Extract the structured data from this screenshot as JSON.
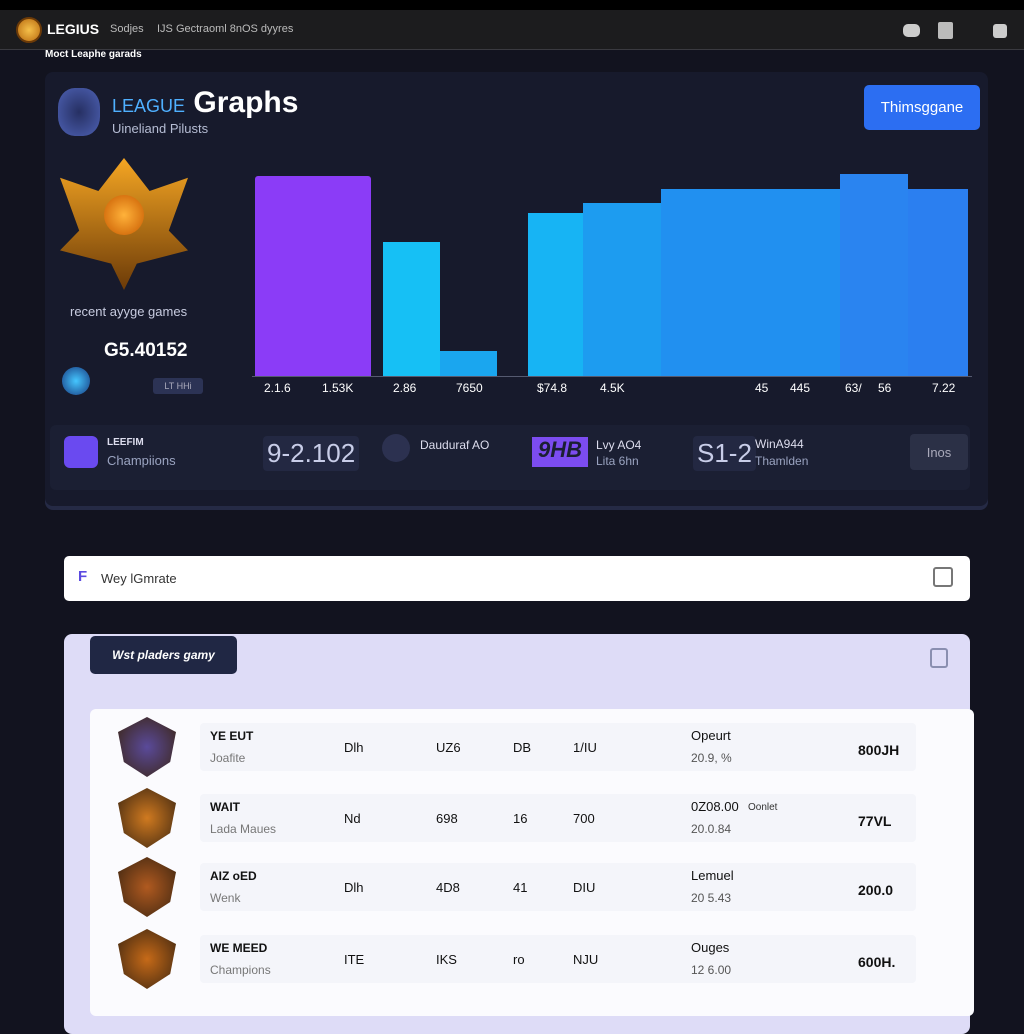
{
  "nav": {
    "brand": "LEGIUS",
    "links": [
      "Sodjes",
      "IJS Gectraoml 8nOS dyyres"
    ],
    "sub_title": "Moct Leaphe garads",
    "icons": [
      "chat-icon",
      "document-icon",
      "user-icon"
    ]
  },
  "header": {
    "title_small": "LEAGUE",
    "title": "Graphs",
    "subtitle": "Uineliand Pilusts",
    "button": "Thimsggane"
  },
  "left": {
    "label": "recent ayyge games",
    "value": "G5.40152",
    "pill": "LT HHi"
  },
  "chart_data": {
    "type": "bar",
    "colors": [
      "#8b3cf7",
      "#16c0f5",
      "#1aa6ef",
      "#17b4f4",
      "#1d9cf0",
      "#2190f0",
      "#2a84f0",
      "#2b7ff0"
    ],
    "levels_percent": [
      97,
      65,
      12,
      79,
      84,
      91,
      98,
      91
    ],
    "tick_labels": [
      "2.1.6",
      "1.53K",
      "2.86",
      "7650",
      "$74.8",
      "4.5K",
      "45",
      "445",
      "63/",
      "56",
      "7.22"
    ]
  },
  "stats": [
    {
      "title": "LEEFIM",
      "sub": "Champiions"
    },
    {
      "big": "9-2.102"
    },
    {
      "title": "Dauduraf AO"
    },
    {
      "big": "9HB",
      "title": "Lvy AO4",
      "sub": "Lita 6hn"
    },
    {
      "big": "S1-2",
      "title": "WinA944",
      "sub": "Thamlden"
    }
  ],
  "stats_button": "Inos",
  "search": {
    "prefix": "F",
    "value": "Wey lGmrate"
  },
  "card": {
    "chip": "Wst pladers gamy",
    "rows": [
      {
        "name": "YE EUT",
        "sub": "Joafite",
        "c1": "Dlh",
        "c2": "UZ6",
        "c3": "DB",
        "c4": "1/IU",
        "stat": "Opeurt",
        "stat_sub": "20.9, %",
        "tag": "",
        "total": "800JH"
      },
      {
        "name": "WAIT",
        "sub": "Lada Maues",
        "c1": "Nd",
        "c2": "698",
        "c3": "16",
        "c4": "700",
        "stat": "0Z08.00",
        "stat_sub": "20.0.84",
        "tag": "Oonlet",
        "total": "77VL"
      },
      {
        "name": "AIZ oED",
        "sub": "Wenk",
        "c1": "Dlh",
        "c2": "4D8",
        "c3": "41",
        "c4": "DIU",
        "stat": "Lemuel",
        "stat_sub": "20 5.43",
        "tag": "",
        "total": "200.0"
      },
      {
        "name": "WE MEED",
        "sub": "Champions",
        "c1": "ITE",
        "c2": "IKS",
        "c3": "ro",
        "c4": "NJU",
        "stat": "Ouges",
        "stat_sub": "12 6.00",
        "tag": "",
        "total": "600H."
      }
    ]
  }
}
